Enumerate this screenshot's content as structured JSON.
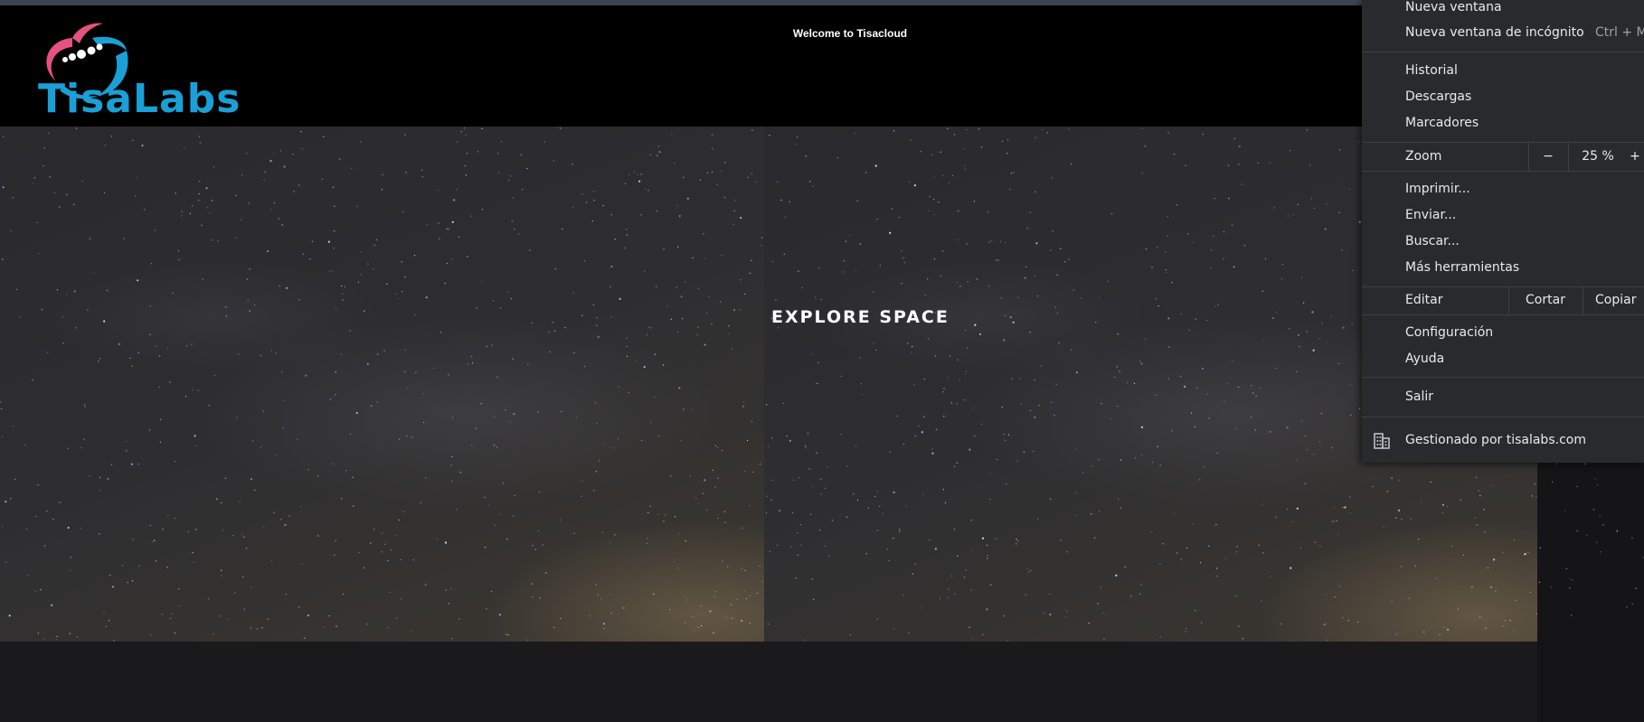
{
  "header": {
    "welcome_text": "Welcome to Tisacloud",
    "logo_text": "TisaLabs",
    "logo_colors": {
      "pink": "#e5527f",
      "blue": "#1aa0d6"
    }
  },
  "hero": {
    "title": "EXPLORE SPACE"
  },
  "context_menu": {
    "new_window": "Nueva ventana",
    "new_incognito": "Nueva ventana de incógnito",
    "new_incognito_shortcut": "Ctrl + M",
    "history": "Historial",
    "downloads": "Descargas",
    "bookmarks": "Marcadores",
    "zoom_label": "Zoom",
    "zoom_minus": "−",
    "zoom_value": "25 %",
    "zoom_plus": "+",
    "print": "Imprimir...",
    "send": "Enviar...",
    "find": "Buscar...",
    "more_tools": "Más herramientas",
    "edit_label": "Editar",
    "cut": "Cortar",
    "copy": "Copiar",
    "settings": "Configuración",
    "help": "Ayuda",
    "exit": "Salir",
    "managed_by": "Gestionado por tisalabs.com",
    "managed_icon": "building-icon"
  }
}
